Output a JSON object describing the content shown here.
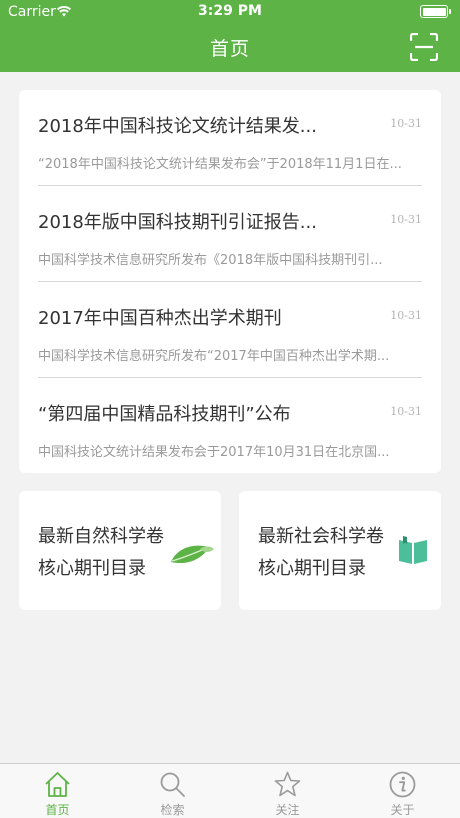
{
  "status_bar": {
    "carrier": "Carrier",
    "time": "3:29 PM"
  },
  "header": {
    "title": "首页"
  },
  "news": [
    {
      "title": "2018年中国科技论文统计结果发...",
      "date": "10-31",
      "summary": "“2018年中国科技论文统计结果发布会”于2018年11月1日在..."
    },
    {
      "title": "2018年版中国科技期刊引证报告...",
      "date": "10-31",
      "summary": "中国科学技术信息研究所发布《2018年版中国科技期刊引..."
    },
    {
      "title": "2017年中国百种杰出学术期刊",
      "date": "10-31",
      "summary": "中国科学技术信息研究所发布“2017年中国百种杰出学术期..."
    },
    {
      "title": "“第四届中国精品科技期刊”公布",
      "date": "10-31",
      "summary": "中国科技论文统计结果发布会于2017年10月31日在北京国..."
    }
  ],
  "categories": [
    {
      "line1": "最新自然科学卷",
      "line2": "核心期刊目录",
      "icon": "leaf-icon"
    },
    {
      "line1": "最新社会科学卷",
      "line2": "核心期刊目录",
      "icon": "book-icon"
    }
  ],
  "tabs": [
    {
      "label": "首页",
      "icon": "home-icon",
      "active": true
    },
    {
      "label": "检索",
      "icon": "search-icon",
      "active": false
    },
    {
      "label": "关注",
      "icon": "star-icon",
      "active": false
    },
    {
      "label": "关于",
      "icon": "info-icon",
      "active": false
    }
  ],
  "colors": {
    "accent": "#5db346",
    "background": "#f2f2f2",
    "card": "#ffffff",
    "tab_inactive": "#9a9a9a",
    "book": "#4cbf9a"
  }
}
